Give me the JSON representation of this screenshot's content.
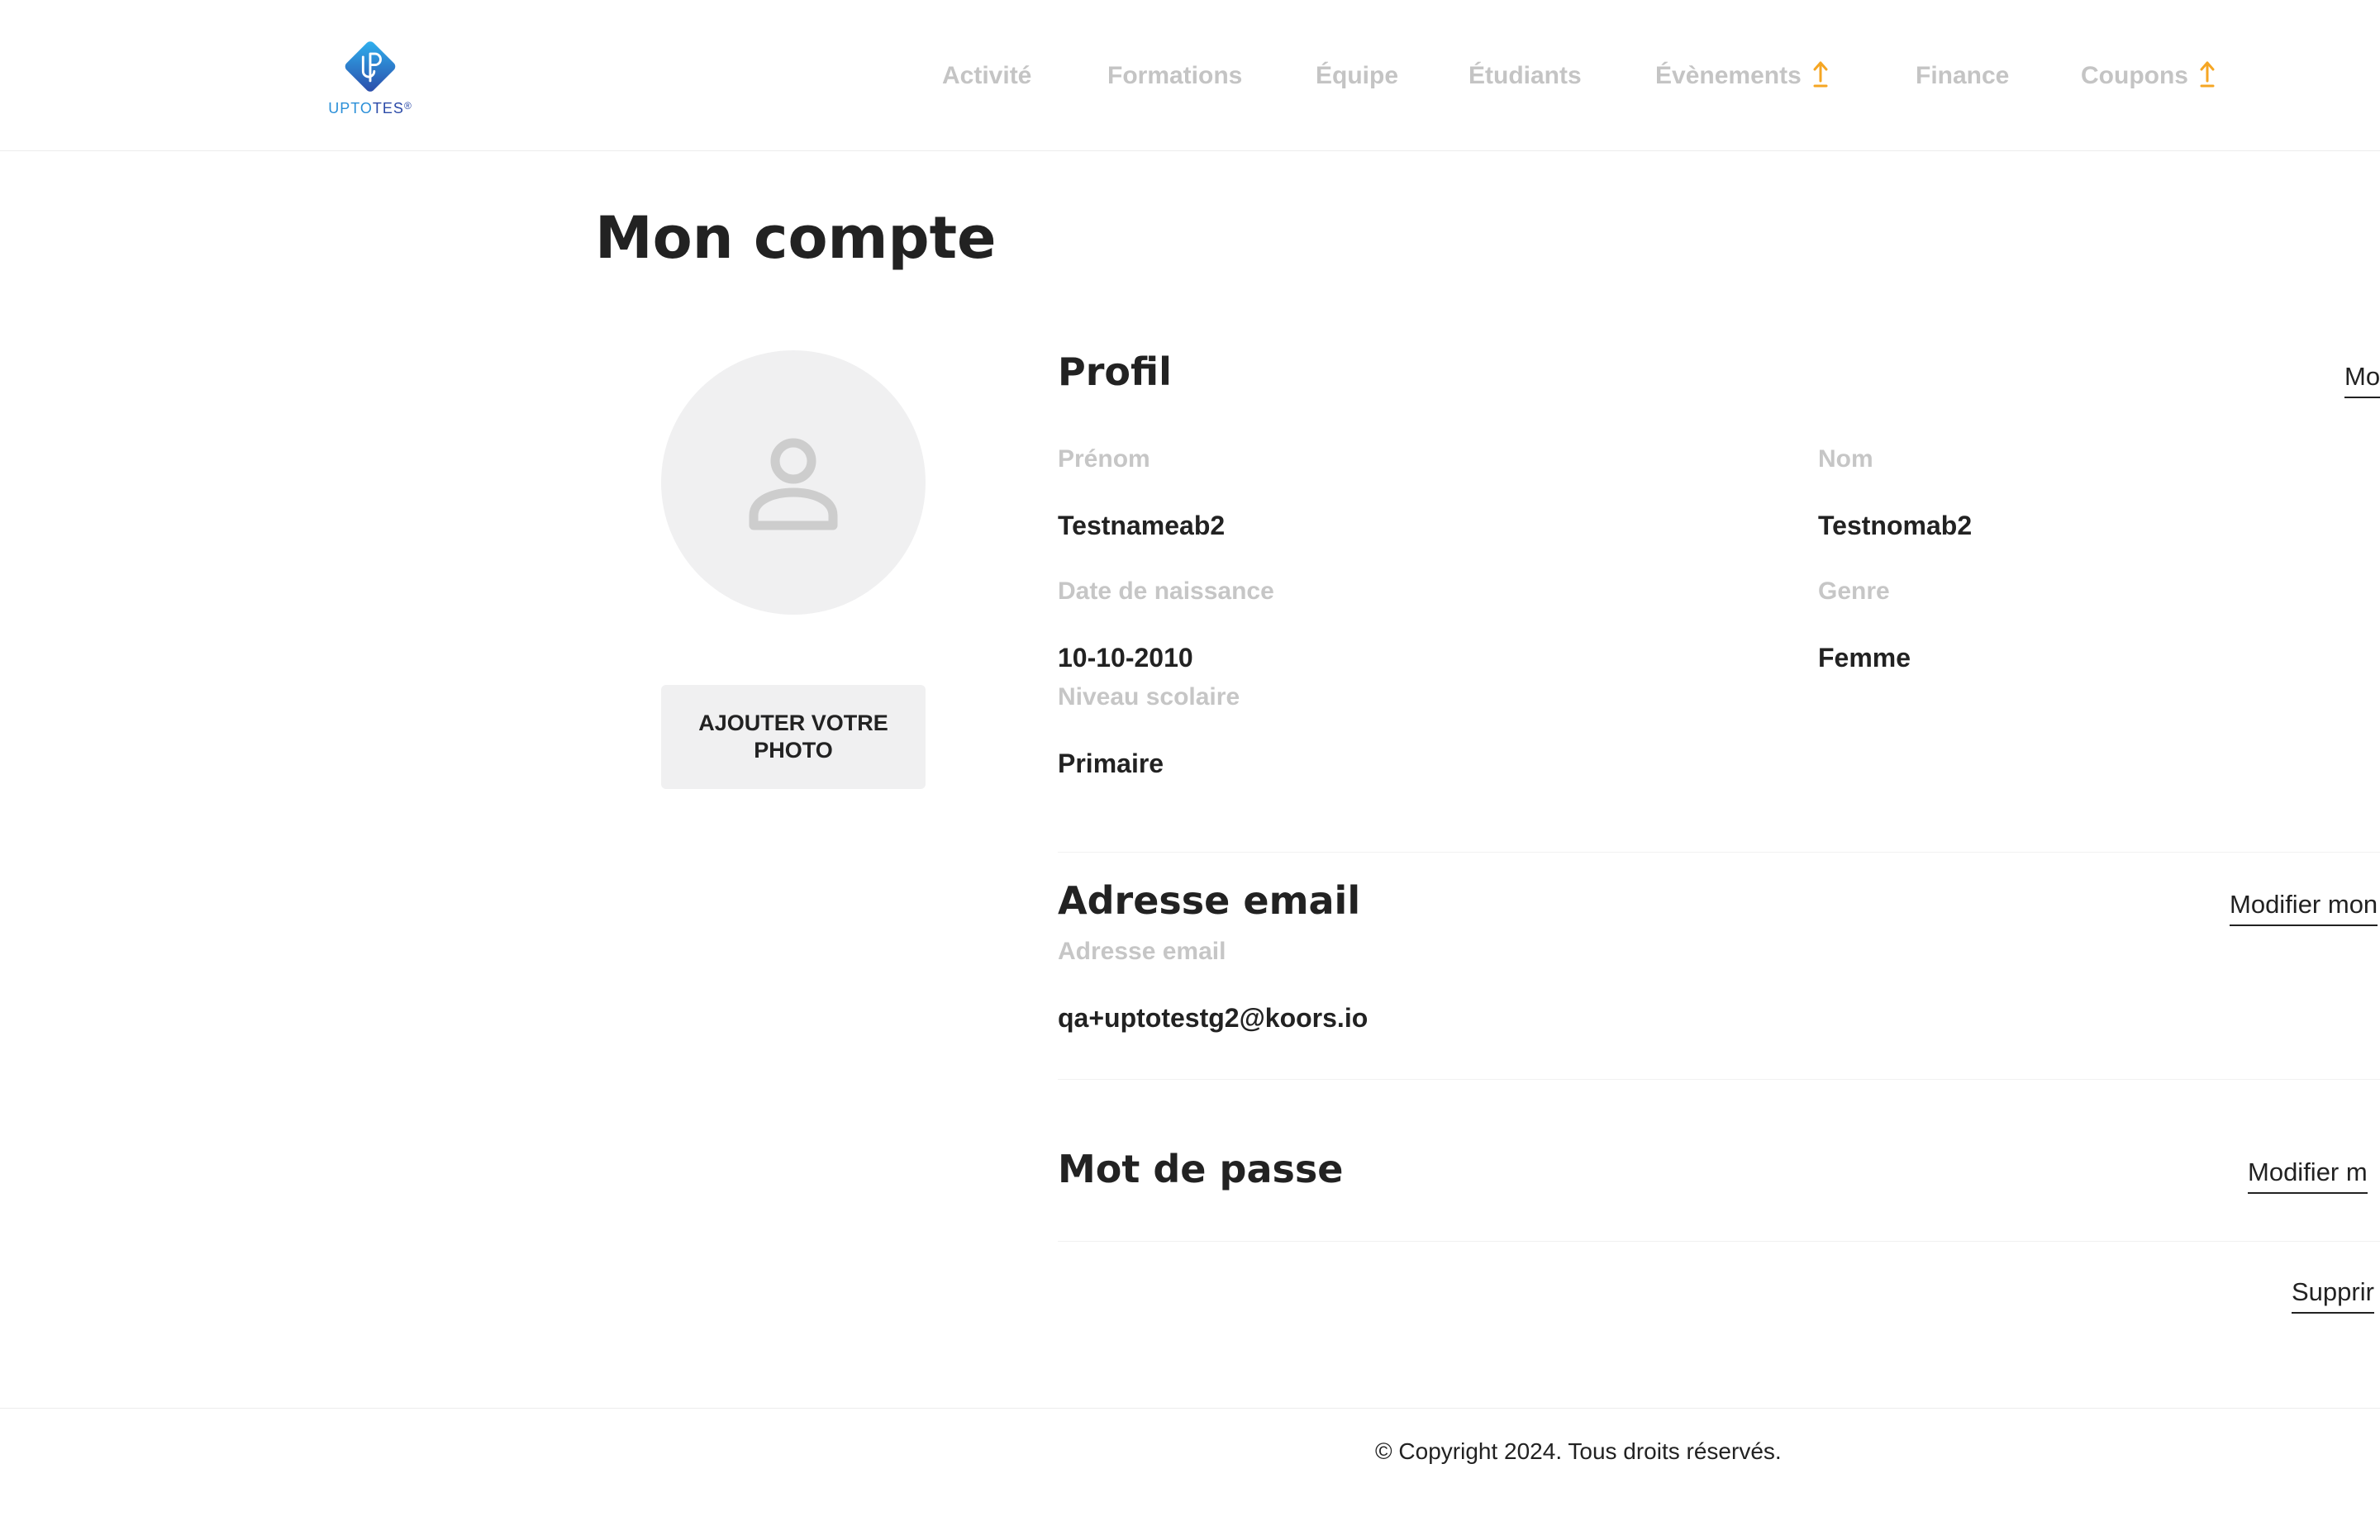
{
  "brand": {
    "logo_icon": "uptotes-logo-icon",
    "name_part1": "UPTO",
    "name_part2": "TES",
    "name_mark": "®",
    "colors": {
      "blue": "#2a8fd8",
      "dark_blue": "#2b4aa8"
    }
  },
  "nav": {
    "items": [
      {
        "label": "Activité"
      },
      {
        "label": "Formations"
      },
      {
        "label": "Équipe"
      },
      {
        "label": "Étudiants"
      },
      {
        "label": "Évènements",
        "badge_icon": "upgrade-arrow-icon"
      },
      {
        "label": "Finance"
      },
      {
        "label": "Coupons",
        "badge_icon": "upgrade-arrow-icon"
      }
    ],
    "badge_color": "#f5a623"
  },
  "page": {
    "title": "Mon compte"
  },
  "avatar": {
    "icon": "user-placeholder-icon",
    "add_photo_label": "AJOUTER VOTRE PHOTO"
  },
  "profile": {
    "title": "Profil",
    "edit_label": "Mo",
    "fields": {
      "first_name": {
        "label": "Prénom",
        "value": "Testnameab2"
      },
      "last_name": {
        "label": "Nom",
        "value": "Testnomab2"
      },
      "birth_date": {
        "label": "Date de naissance",
        "value": "10-10-2010"
      },
      "gender": {
        "label": "Genre",
        "value": "Femme"
      },
      "school_level": {
        "label": "Niveau scolaire",
        "value": "Primaire"
      }
    }
  },
  "email": {
    "title": "Adresse email",
    "edit_label": "Modifier mon",
    "label": "Adresse email",
    "value": "qa+uptotestg2@koors.io"
  },
  "password": {
    "title": "Mot de passe",
    "edit_label": "Modifier m"
  },
  "delete": {
    "label": "Supprir"
  },
  "footer": {
    "copyright": "© Copyright 2024. Tous droits réservés."
  }
}
